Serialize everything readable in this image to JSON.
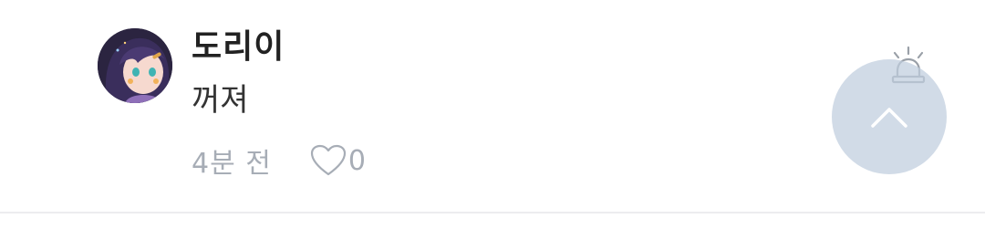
{
  "comment": {
    "nickname": "도리이",
    "text": "꺼져",
    "time": "4분 전",
    "like_count": "0"
  },
  "icons": {
    "like": "heart-outline-icon",
    "report": "siren-icon",
    "scroll_top": "chevron-up-icon"
  },
  "colors": {
    "meta_text": "#a7adb6",
    "scroll_top_button": "#bfcdde"
  }
}
